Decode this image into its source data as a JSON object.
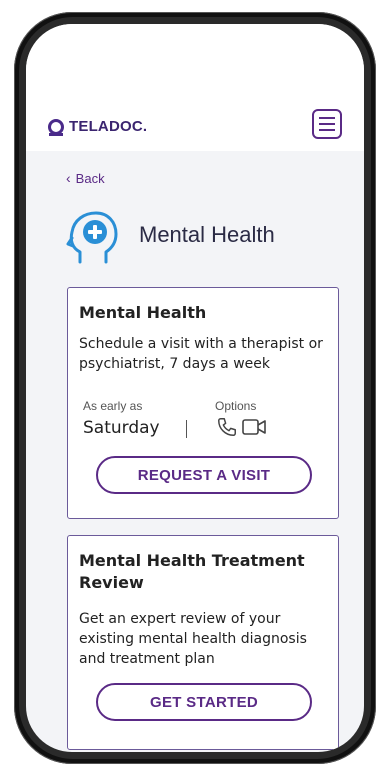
{
  "header": {
    "brand": "TELADOC.",
    "menu_icon": "hamburger-menu-icon"
  },
  "nav": {
    "back_label": "Back",
    "back_icon": "chevron-left-icon"
  },
  "page": {
    "title": "Mental Health",
    "icon": "head-plus-icon"
  },
  "cards": [
    {
      "title": "Mental Health",
      "description": "Schedule a visit with a therapist or psychiatrist, 7 days a week",
      "availability_label": "As early as",
      "availability_value": "Saturday",
      "options_label": "Options",
      "option_icons": [
        "phone-icon",
        "video-icon"
      ],
      "button_label": "REQUEST A VISIT"
    },
    {
      "title": "Mental Health Treatment Review",
      "description": "Get an expert review of your existing mental health diagnosis and treatment plan",
      "button_label": "GET STARTED"
    }
  ],
  "colors": {
    "brand": "#3b2570",
    "accent": "#5a2a86",
    "icon_blue": "#2a8fd6",
    "background": "#f3f4f7"
  }
}
